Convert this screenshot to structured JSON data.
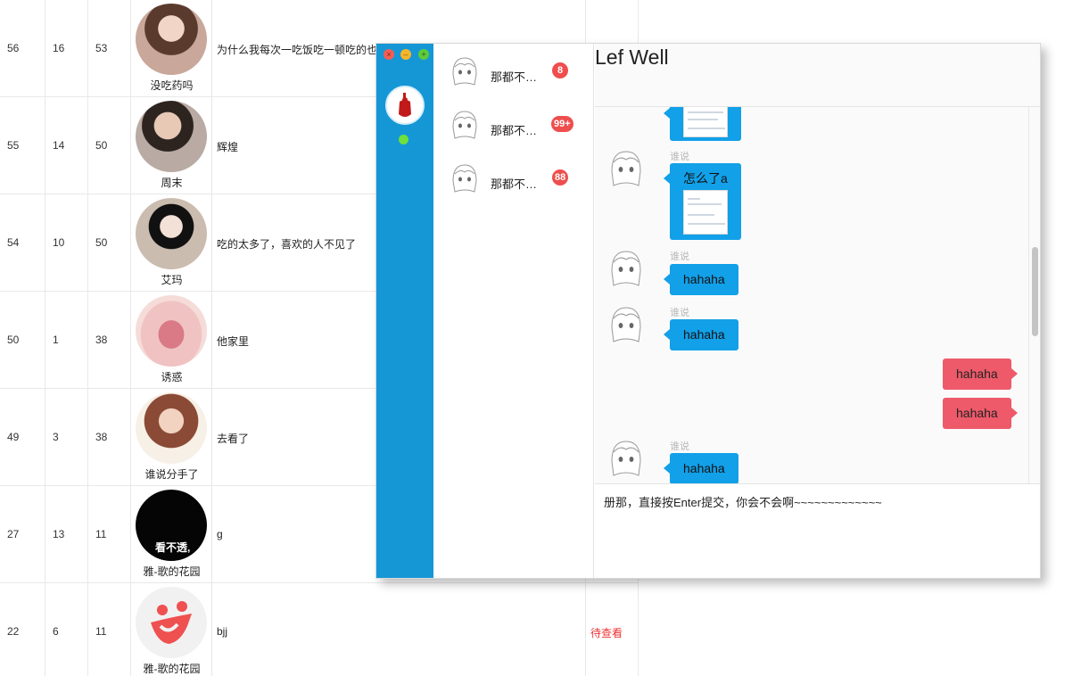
{
  "table": {
    "rows": [
      {
        "c1": "56",
        "c2": "16",
        "c3": "53",
        "nickname": "没吃药吗",
        "message": "为什么我每次一吃饭吃一顿吃的也",
        "status": ""
      },
      {
        "c1": "55",
        "c2": "14",
        "c3": "50",
        "nickname": "周末",
        "message": "辉煌",
        "status": ""
      },
      {
        "c1": "54",
        "c2": "10",
        "c3": "50",
        "nickname": "艾玛",
        "message": "吃的太多了，喜欢的人不见了",
        "status": ""
      },
      {
        "c1": "50",
        "c2": "1",
        "c3": "38",
        "nickname": "诱惑",
        "message": "他家里",
        "status": ""
      },
      {
        "c1": "49",
        "c2": "3",
        "c3": "38",
        "nickname": "谁说分手了",
        "message": "去看了",
        "status": ""
      },
      {
        "c1": "27",
        "c2": "13",
        "c3": "11",
        "nickname": "雅-歌的花园",
        "message": "g",
        "status": "",
        "avatar_text": "看不透,"
      },
      {
        "c1": "22",
        "c2": "6",
        "c3": "11",
        "nickname": "雅-歌的花园",
        "message": "bjj",
        "status": "待查看"
      }
    ]
  },
  "chat": {
    "window_controls": {
      "close": "×",
      "minimize": "–",
      "maximize": "+"
    },
    "title": "Lef Well",
    "conversations": [
      {
        "name": "那都不…",
        "badge": "8"
      },
      {
        "name": "那都不…",
        "badge": "99+"
      },
      {
        "name": "那都不…",
        "badge": "88"
      }
    ],
    "messages": {
      "sender": "谁说",
      "m1_text": "怎么了a",
      "m2_text": "hahaha",
      "m3_text": "hahaha",
      "out1_text": "hahaha",
      "out2_text": "hahaha",
      "m4_text": "hahaha"
    },
    "input_text": "册那，直接按Enter提交，你会不会啊~~~~~~~~~~~~~"
  },
  "colors": {
    "sidebar": "#1597d6",
    "incoming_bubble": "#12a0e8",
    "outgoing_bubble": "#ee5a6a",
    "badge": "#ef4e4e",
    "online": "#6fe03c",
    "status_text": "#e33"
  }
}
